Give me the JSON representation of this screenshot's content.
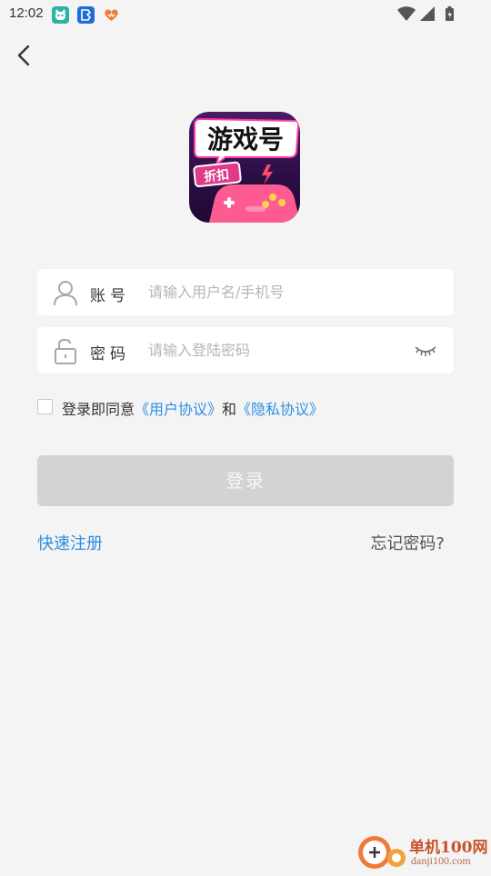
{
  "status_bar": {
    "time": "12:02",
    "icons": [
      "cat-app-icon",
      "blue-app-icon",
      "heart-app-icon"
    ],
    "system_icons": [
      "wifi-icon",
      "signal-icon",
      "battery-icon"
    ]
  },
  "nav": {
    "back_icon": "chevron-left-icon"
  },
  "logo": {
    "title_text": "游戏号",
    "tag_text": "折扣"
  },
  "account": {
    "label": "账号",
    "placeholder": "请输入用户名/手机号",
    "value": ""
  },
  "password": {
    "label": "密码",
    "placeholder": "请输入登陆密码",
    "value": ""
  },
  "agreement": {
    "checked": false,
    "prefix": "登录即同意",
    "user_link": "《用户协议》",
    "and": "和",
    "privacy_link": "《隐私协议》"
  },
  "login_button": "登录",
  "quick_register": "快速注册",
  "forgot_password": "忘记密码?",
  "watermark": {
    "name": "单机100网",
    "url": "danji100.com"
  },
  "colors": {
    "link": "#2d8ee0",
    "button_disabled": "#d3d3d3",
    "background": "#f4f4f5"
  }
}
